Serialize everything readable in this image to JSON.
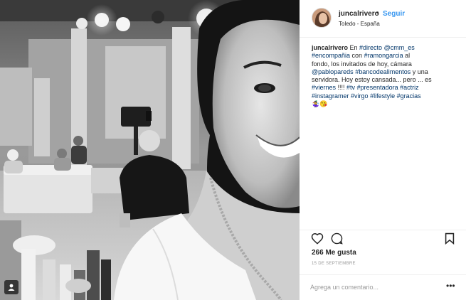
{
  "post": {
    "username": "juncalrivero",
    "separator": "•",
    "follow_label": "Seguir",
    "location": "Toledo - España"
  },
  "caption": {
    "username": "juncalrivero",
    "segments": [
      {
        "t": " En ",
        "tag": false
      },
      {
        "t": "#directo",
        "tag": true
      },
      {
        "t": " ",
        "tag": false
      },
      {
        "t": "@cmm_es",
        "tag": true
      },
      {
        "t": "\n",
        "tag": false
      },
      {
        "t": "#encompañia",
        "tag": true
      },
      {
        "t": " con ",
        "tag": false
      },
      {
        "t": "#ramongarcia",
        "tag": true
      },
      {
        "t": " al\nfondo, los invitados de hoy, cámara\n",
        "tag": false
      },
      {
        "t": "@pablopareds",
        "tag": true
      },
      {
        "t": " ",
        "tag": false
      },
      {
        "t": "#bancodealimentos",
        "tag": true
      },
      {
        "t": " y una\nservidora. Hoy estoy cansada... pero ... es\n",
        "tag": false
      },
      {
        "t": "#viernes",
        "tag": true
      },
      {
        "t": " !!!! ",
        "tag": false
      },
      {
        "t": "#tv",
        "tag": true
      },
      {
        "t": " ",
        "tag": false
      },
      {
        "t": "#presentadora",
        "tag": true
      },
      {
        "t": " ",
        "tag": false
      },
      {
        "t": "#actriz",
        "tag": true
      },
      {
        "t": "\n",
        "tag": false
      },
      {
        "t": "#instagramer",
        "tag": true
      },
      {
        "t": " ",
        "tag": false
      },
      {
        "t": "#virgo",
        "tag": true
      },
      {
        "t": " ",
        "tag": false
      },
      {
        "t": "#lifestyle",
        "tag": true
      },
      {
        "t": " ",
        "tag": false
      },
      {
        "t": "#gracias",
        "tag": true
      },
      {
        "t": "\n🤹‍♀️😘",
        "tag": false
      }
    ]
  },
  "stats": {
    "likes": "266 Me gusta",
    "date": "15 DE SEPTIEMBRE"
  },
  "comment": {
    "placeholder": "Agrega un comentario...",
    "more_label": "•••"
  },
  "icons": {
    "like": "heart-icon",
    "comment": "comment-bubble-icon",
    "save": "bookmark-icon",
    "badge": "tagged-user-icon"
  },
  "colors": {
    "link": "#3897f0",
    "hashtag": "#003569",
    "text": "#262626",
    "muted": "#999999",
    "border": "#efefef"
  }
}
